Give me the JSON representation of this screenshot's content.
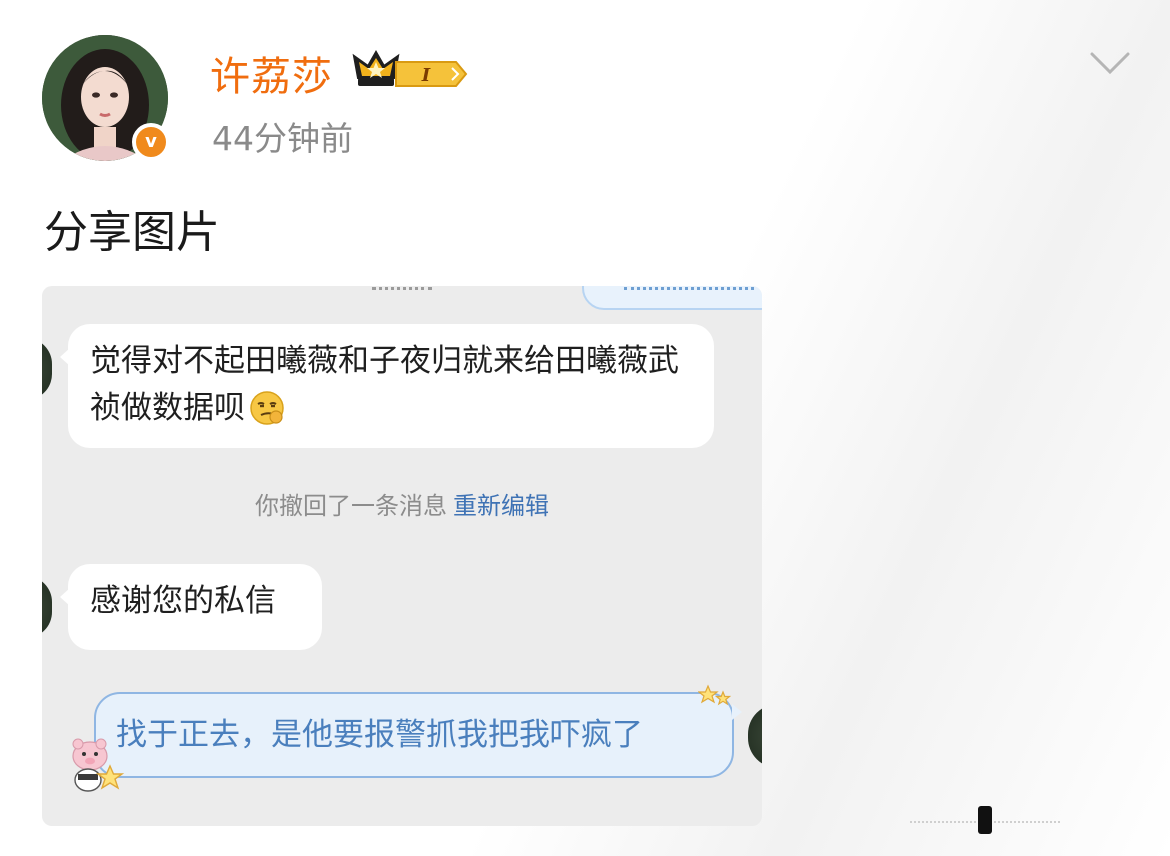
{
  "post": {
    "author": {
      "name": "许荔莎",
      "verified_mark": "v",
      "level_badge": "I",
      "avatar_icon": "user-avatar"
    },
    "timestamp": "44分钟前",
    "text": "分享图片",
    "more_icon": "chevron-down-icon"
  },
  "chat_image": {
    "messages": [
      {
        "side": "left",
        "text": "觉得对不起田曦薇和子夜归就来给田曦薇武祯做数据呗",
        "emoji": "smirk-face-emoji"
      },
      {
        "side": "left",
        "text": "感谢您的私信"
      }
    ],
    "system_notice": {
      "text": "你撤回了一条消息",
      "action": "重新编辑"
    },
    "outgoing": {
      "text": "找于正去，是他要报警抓我把我吓疯了"
    }
  },
  "colors": {
    "username": "#f06d0f",
    "timestamp": "#8a8a8a",
    "chat_bg": "#ececec",
    "outgoing_bubble": "#e7f1fb",
    "outgoing_text": "#4a7fbd",
    "link": "#3f73b5"
  }
}
